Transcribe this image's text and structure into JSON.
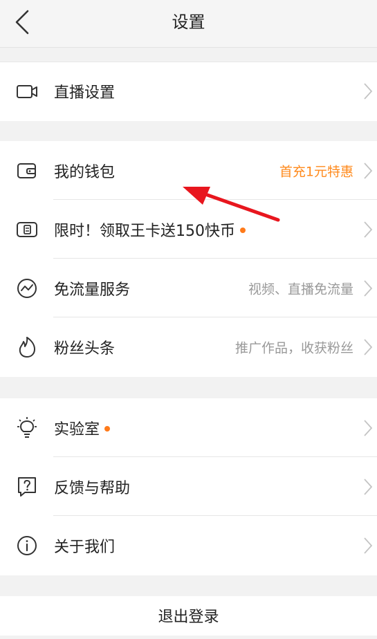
{
  "header": {
    "title": "设置"
  },
  "section1": {
    "items": [
      {
        "label": "直播设置",
        "icon": "video-camera-icon"
      }
    ]
  },
  "section2": {
    "items": [
      {
        "label": "我的钱包",
        "right": "首充1元特惠",
        "right_color": "#ff8a1c",
        "icon": "wallet-icon"
      },
      {
        "label": "限时！领取王卡送150快币",
        "dot": true,
        "icon": "sim-card-icon"
      },
      {
        "label": "免流量服务",
        "right": "视频、直播免流量",
        "icon": "wave-circle-icon"
      },
      {
        "label": "粉丝头条",
        "right": "推广作品，收获粉丝",
        "icon": "flame-icon"
      }
    ]
  },
  "section3": {
    "items": [
      {
        "label": "实验室",
        "dot": true,
        "icon": "lightbulb-icon"
      },
      {
        "label": "反馈与帮助",
        "icon": "question-bubble-icon"
      },
      {
        "label": "关于我们",
        "icon": "info-circle-icon"
      }
    ]
  },
  "footer": {
    "logout_label": "退出登录"
  },
  "colors": {
    "accent": "#ff8a1c",
    "dot": "#ff7a1a",
    "annotation_arrow": "#e8161e",
    "background": "#f2f2f2"
  }
}
